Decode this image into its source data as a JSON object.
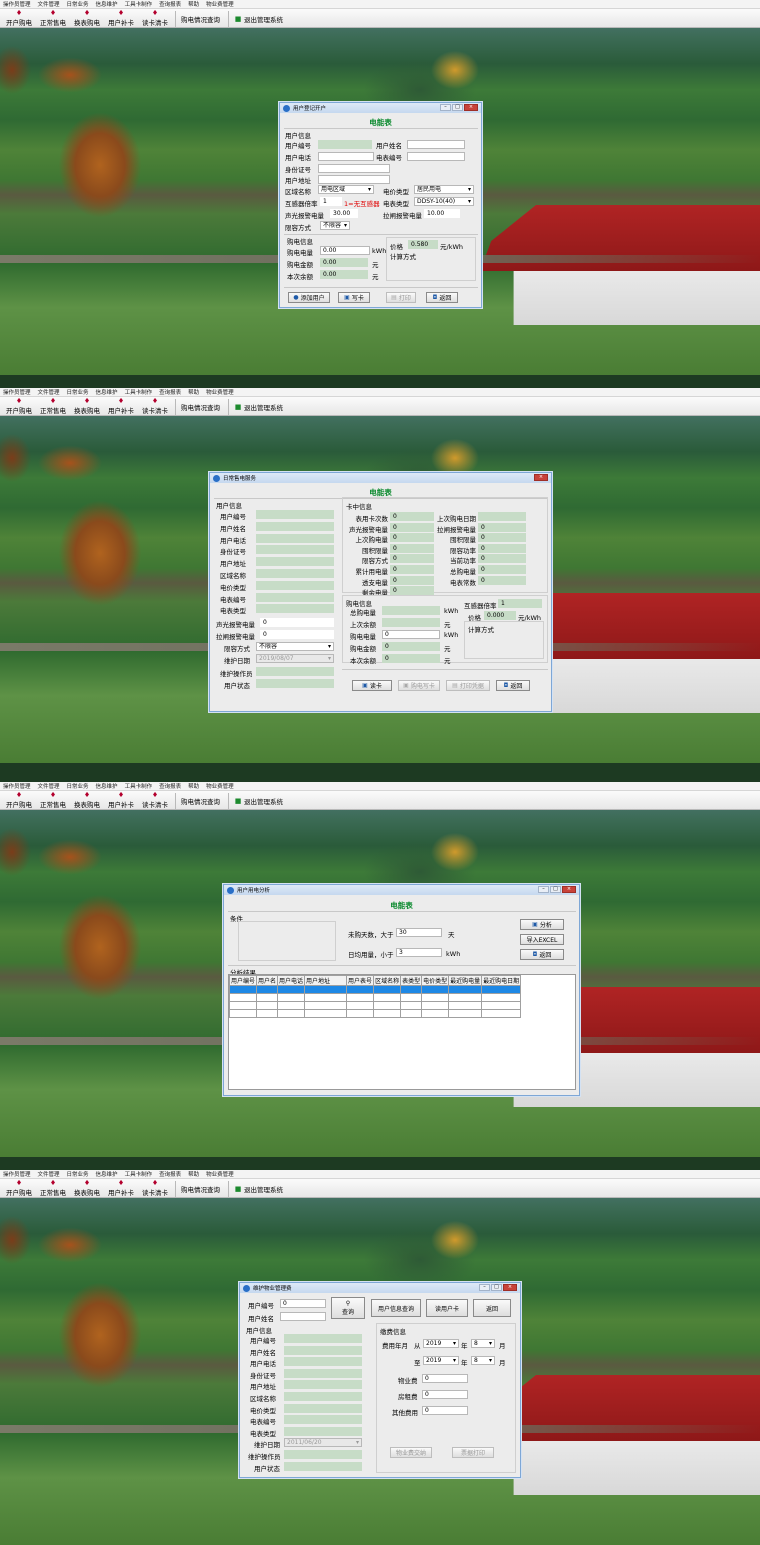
{
  "menu": [
    "操作员管理",
    "文件管理",
    "日常业务",
    "信息维护",
    "工具卡制作",
    "查询报表",
    "帮助",
    "物业费管理"
  ],
  "toolbar": [
    "开户购电",
    "正常售电",
    "换表购电",
    "用户补卡",
    "读卡清卡"
  ],
  "toolbar_wide": [
    "购电情况查询",
    "退出管理系统"
  ],
  "win1": {
    "title": "用户登记开户",
    "header": "电能表",
    "user_info": "用户信息",
    "user_no": "用户编号",
    "user_name": "用户姓名",
    "phone": "用户电话",
    "meter_no": "电表编号",
    "id_no": "身份证号",
    "address": "用户地址",
    "area": "区域名称",
    "area_val": "用电区域",
    "price_type": "电价类型",
    "price_type_val": "居民用电",
    "ct_ratio": "互感器倍率",
    "ct_ratio_val": "1",
    "ct_note": "1=无互感器",
    "meter_type": "电表类型",
    "meter_type_val": "DDSY-10(40)",
    "alarm1": "声光报警电量",
    "alarm1_val": "30.00",
    "alarm2": "拉闸报警电量",
    "alarm2_val": "10.00",
    "limit": "限容方式",
    "limit_val": "不限容",
    "buy_info": "购电信息",
    "buy_kwh": "购电电量",
    "buy_kwh_val": "0.00",
    "unit_kwh": "kWh",
    "buy_amt": "购电金额",
    "buy_amt_val": "0.00",
    "unit_yuan": "元",
    "balance": "本次余额",
    "balance_val": "0.00",
    "price": "价格",
    "price_val": "0.580",
    "price_unit": "元/kWh",
    "calc": "计算方式",
    "btn_add": "添加用户",
    "btn_write": "写卡",
    "btn_print": "打印",
    "btn_back": "返回"
  },
  "win2": {
    "title": "日常售电服务",
    "header": "电能表",
    "user_info": "用户信息",
    "left_labels": [
      "用户编号",
      "用户姓名",
      "用户电话",
      "身份证号",
      "用户地址",
      "区域名称",
      "电价类型",
      "电表编号",
      "电表类型"
    ],
    "alarm1": "声光报警电量",
    "alarm1_val": "0",
    "alarm2": "拉闸报警电量",
    "alarm2_val": "0",
    "limit": "限容方式",
    "limit_val": "不限容",
    "maint_date": "维护日期",
    "maint_date_val": "2019/08/07",
    "maint_op": "维护操作员",
    "user_state": "用户状态",
    "card_info": "卡中信息",
    "card_col1": [
      "表用卡次数",
      "声光报警电量",
      "上次购电量",
      "囤积限量",
      "限容方式",
      "累计用电量",
      "透支电量",
      "剩余电量"
    ],
    "card_col1_vals": [
      "0",
      "0",
      "0",
      "0",
      "0",
      "0",
      "0",
      "0"
    ],
    "card_col2": [
      "上次购电日期",
      "拉闸报警电量",
      "囤积限量",
      "限容功率",
      "当前功率",
      "总购电量",
      "电表常数"
    ],
    "card_col2_vals": [
      "",
      "0",
      "0",
      "0",
      "0",
      "0",
      "0"
    ],
    "buy_info": "购电信息",
    "total_buy": "总购电量",
    "last_bal": "上次余额",
    "buy_kwh": "购电电量",
    "buy_kwh_val": "0",
    "buy_amt": "购电金额",
    "buy_amt_val": "0",
    "this_bal": "本次余额",
    "this_bal_val": "0",
    "unit_kwh": "kWh",
    "unit_yuan": "元",
    "ct_ratio": "互感器倍率",
    "ct_ratio_val": "1",
    "price": "价格",
    "price_val": "0.000",
    "price_unit": "元/kWh",
    "calc": "计算方式",
    "btn_read": "读卡",
    "btn_write": "购电写卡",
    "btn_print": "打印凭据",
    "btn_back": "返回"
  },
  "win3": {
    "title": "用户用电分析",
    "header": "电能表",
    "cond": "条件",
    "days_label": "未购天数，大于",
    "days_val": "30",
    "days_unit": "天",
    "daily_label": "日均用量，小于",
    "daily_val": "3",
    "daily_unit": "kWh",
    "btn_analyze": "分析",
    "btn_excel": "导入EXCEL",
    "btn_back": "返回",
    "result": "分析结果",
    "columns": [
      "用户编号",
      "用户名",
      "用户电话",
      "用户地址",
      "用户表号",
      "区域名称",
      "表类型",
      "电价类型",
      "最近购电量",
      "最近购电日期"
    ]
  },
  "win4": {
    "title": "维护物业管理费",
    "user_no": "用户编号",
    "user_no_val": "0",
    "user_name": "用户姓名",
    "btn_query": "查询",
    "btn_info": "用户信息查询",
    "btn_read": "读用户卡",
    "btn_back": "返回",
    "user_info": "用户信息",
    "left_labels": [
      "用户编号",
      "用户姓名",
      "用户电话",
      "身份证号",
      "用户地址",
      "区域名称",
      "电价类型",
      "电表编号",
      "电表类型"
    ],
    "maint_date": "维护日期",
    "maint_date_val": "2011/06/20",
    "maint_op": "维护操作员",
    "user_state": "用户状态",
    "fee_info": "缴费信息",
    "fee_month": "费用年月",
    "from": "从",
    "to": "至",
    "year1": "2019",
    "month1": "8",
    "year2": "2019",
    "month2": "8",
    "nian": "年",
    "yue": "月",
    "prop_fee": "物业费",
    "prop_fee_val": "0",
    "rent": "房租费",
    "rent_val": "0",
    "other": "其他费用",
    "other_val": "0",
    "btn_pay": "物业费交纳",
    "btn_print": "票据打印"
  }
}
